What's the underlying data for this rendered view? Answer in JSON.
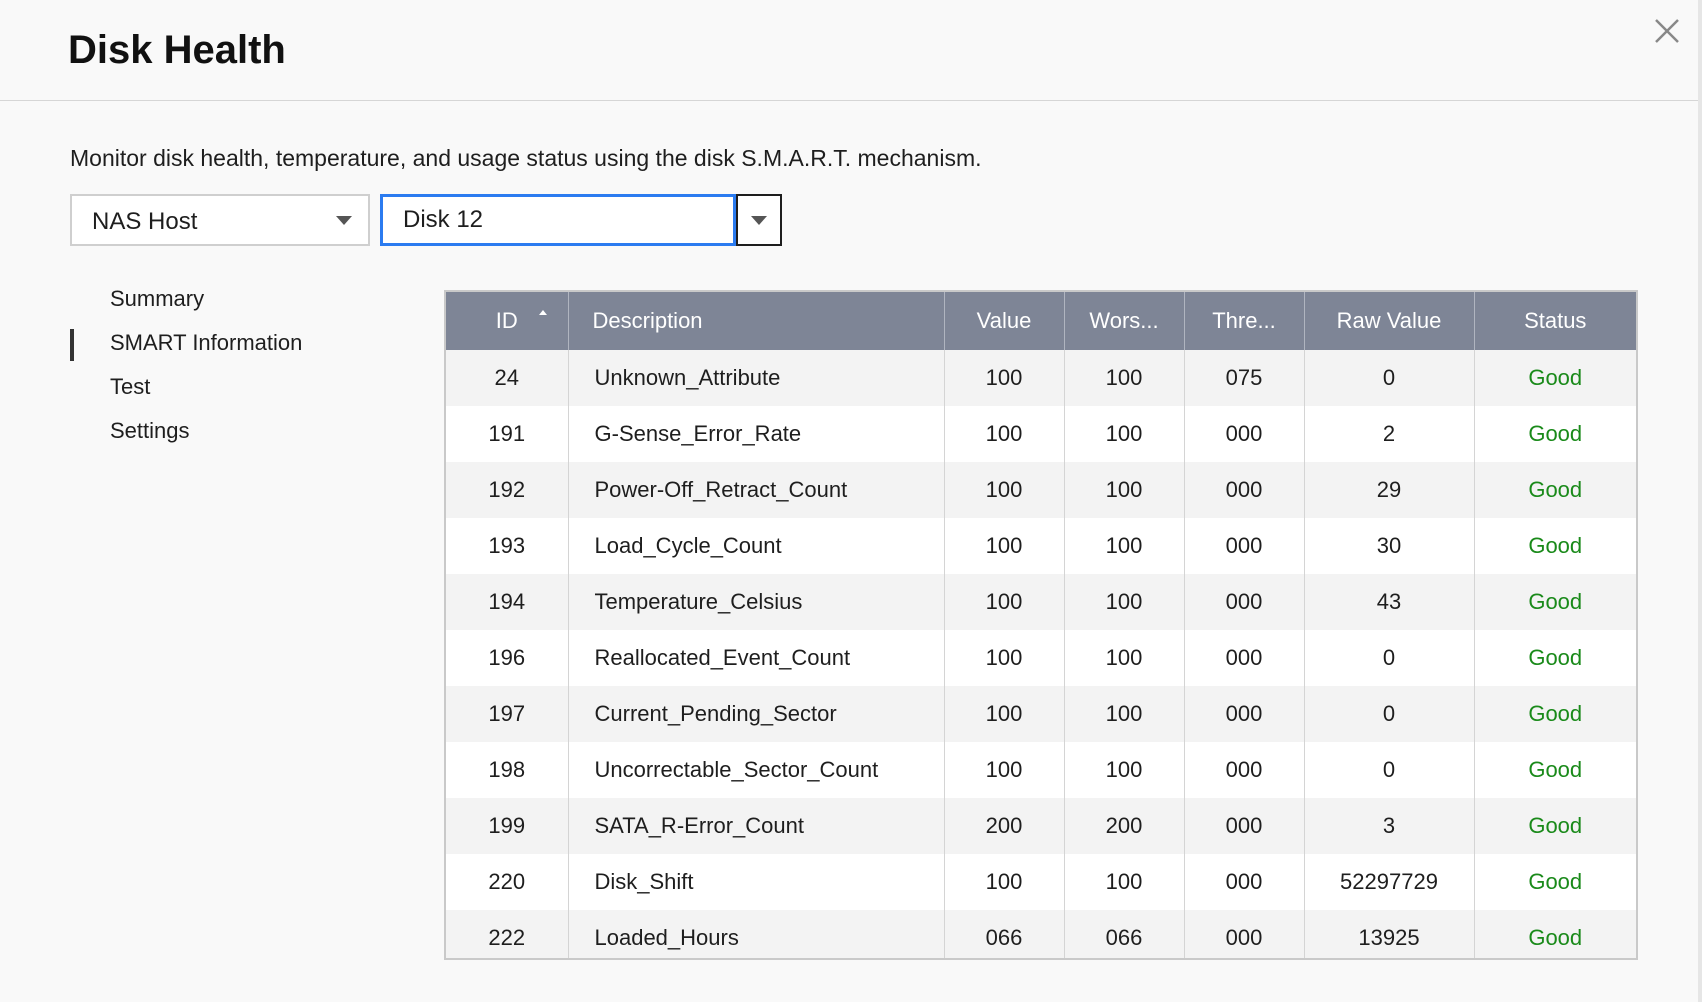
{
  "window": {
    "title": "Disk Health",
    "close_icon": "close-icon"
  },
  "description": "Monitor disk health, temperature, and usage status using the disk S.M.A.R.T. mechanism.",
  "selectors": {
    "host": "NAS Host",
    "disk": "Disk 12"
  },
  "nav": {
    "items": [
      {
        "label": "Summary",
        "active": false
      },
      {
        "label": "SMART Information",
        "active": true
      },
      {
        "label": "Test",
        "active": false
      },
      {
        "label": "Settings",
        "active": false
      }
    ]
  },
  "table": {
    "columns": [
      "ID",
      "Description",
      "Value",
      "Wors...",
      "Thre...",
      "Raw Value",
      "Status"
    ],
    "sort_column": "ID",
    "rows": [
      {
        "id": "24",
        "desc": "Unknown_Attribute",
        "value": "100",
        "worst": "100",
        "thresh": "075",
        "raw": "0",
        "status": "Good"
      },
      {
        "id": "191",
        "desc": "G-Sense_Error_Rate",
        "value": "100",
        "worst": "100",
        "thresh": "000",
        "raw": "2",
        "status": "Good"
      },
      {
        "id": "192",
        "desc": "Power-Off_Retract_Count",
        "value": "100",
        "worst": "100",
        "thresh": "000",
        "raw": "29",
        "status": "Good"
      },
      {
        "id": "193",
        "desc": "Load_Cycle_Count",
        "value": "100",
        "worst": "100",
        "thresh": "000",
        "raw": "30",
        "status": "Good"
      },
      {
        "id": "194",
        "desc": "Temperature_Celsius",
        "value": "100",
        "worst": "100",
        "thresh": "000",
        "raw": "43",
        "status": "Good"
      },
      {
        "id": "196",
        "desc": "Reallocated_Event_Count",
        "value": "100",
        "worst": "100",
        "thresh": "000",
        "raw": "0",
        "status": "Good"
      },
      {
        "id": "197",
        "desc": "Current_Pending_Sector",
        "value": "100",
        "worst": "100",
        "thresh": "000",
        "raw": "0",
        "status": "Good"
      },
      {
        "id": "198",
        "desc": "Uncorrectable_Sector_Count",
        "value": "100",
        "worst": "100",
        "thresh": "000",
        "raw": "0",
        "status": "Good"
      },
      {
        "id": "199",
        "desc": "SATA_R-Error_Count",
        "value": "200",
        "worst": "200",
        "thresh": "000",
        "raw": "3",
        "status": "Good"
      },
      {
        "id": "220",
        "desc": "Disk_Shift",
        "value": "100",
        "worst": "100",
        "thresh": "000",
        "raw": "52297729",
        "status": "Good"
      },
      {
        "id": "222",
        "desc": "Loaded_Hours",
        "value": "066",
        "worst": "066",
        "thresh": "000",
        "raw": "13925",
        "status": "Good"
      }
    ]
  },
  "colors": {
    "header_bg": "#7e8596",
    "status_good": "#1a8a1a",
    "focus_border": "#2b7bf0"
  }
}
